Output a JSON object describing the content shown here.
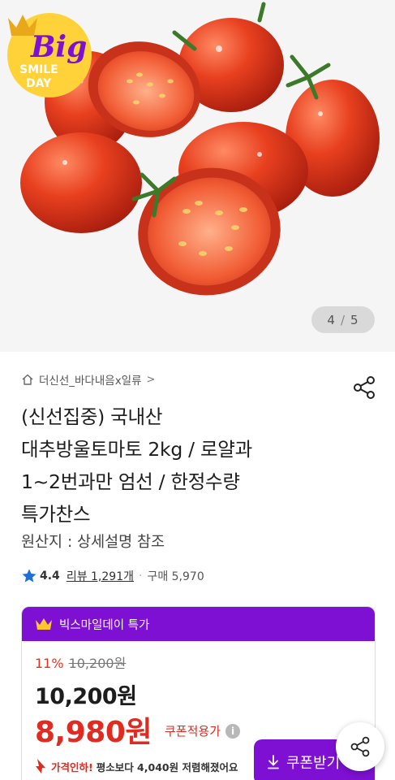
{
  "gallery": {
    "badge": {
      "line1": "Big",
      "line2": "SMILE",
      "line3": "DAY"
    },
    "indicator": {
      "current": "4",
      "separator": "/",
      "total": "5"
    }
  },
  "product": {
    "store_name": "더신선_바다내음x일류",
    "store_chevron": ">",
    "title": "(신선집중) 국내산\n대추방울토마토 2kg / 로얄과\n1~2번과만 엄선 / 한정수량\n특가찬스",
    "origin": "원산지 : 상세설명 참조",
    "rating": "4.4",
    "review_label": "리뷰 1,291개",
    "separator": "·",
    "purchase_label": "구매 5,970"
  },
  "promo": {
    "header": "빅스마일데이 특가",
    "discount_pct": "11%",
    "original_price": "10,200원",
    "price": "10,200원",
    "coupon_price": "8,980원",
    "coupon_label": "쿠폰적용가",
    "info_mark": "i",
    "coupon_button": "쿠폰받기",
    "price_down_prefix": "가격인하!",
    "price_down_text": "평소보다 4,040원 저렴해졌어요"
  },
  "colors": {
    "accent_purple": "#7d10d3",
    "price_red": "#e12a20",
    "star_blue": "#1e6fd9"
  },
  "icons": {
    "home": "home-icon",
    "share": "share-icon",
    "star": "star-icon",
    "crown": "crown-icon",
    "download": "download-icon",
    "price_down": "arrow-down-icon",
    "info": "info-icon"
  }
}
